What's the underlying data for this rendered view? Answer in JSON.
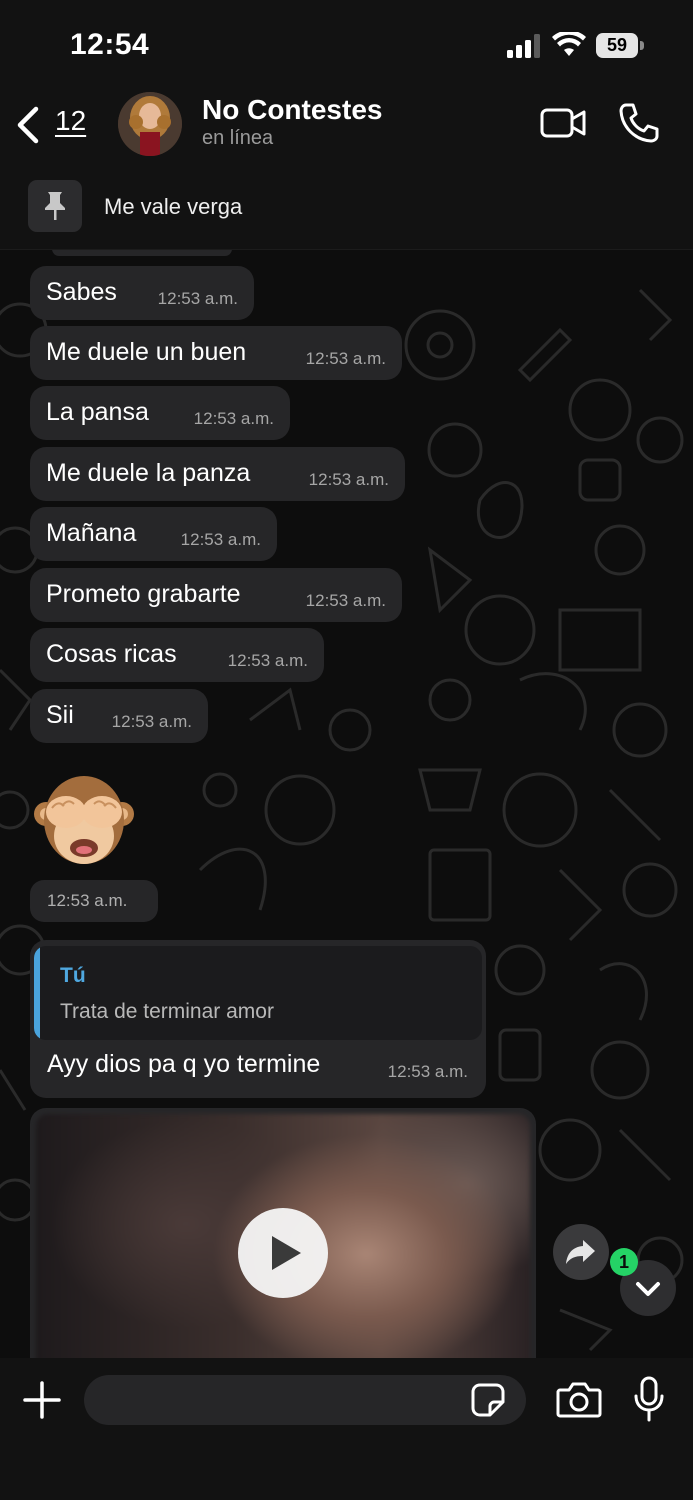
{
  "status_bar": {
    "time": "12:54",
    "battery": "59"
  },
  "header": {
    "back_count": "12",
    "contact_name": "No Contestes",
    "contact_status": "en línea"
  },
  "pinned": {
    "text": "Me vale verga"
  },
  "messages": [
    {
      "text": "Sabes",
      "time": "12:53 a.m."
    },
    {
      "text": "Me duele un buen",
      "time": "12:53 a.m."
    },
    {
      "text": "La pansa",
      "time": "12:53 a.m."
    },
    {
      "text": "Me duele la panza",
      "time": "12:53 a.m."
    },
    {
      "text": "Mañana",
      "time": "12:53 a.m."
    },
    {
      "text": "Prometo grabarte",
      "time": "12:53 a.m."
    },
    {
      "text": "Cosas ricas",
      "time": "12:53 a.m."
    },
    {
      "text": "Sii",
      "time": "12:53 a.m."
    }
  ],
  "emoji_message": {
    "emoji": "see-no-evil-monkey",
    "time": "12:53 a.m."
  },
  "reply_message": {
    "quoted_author": "Tú",
    "quoted_text": "Trata de terminar amor",
    "text": "Ayy dios pa q yo termine",
    "time": "12:53 a.m."
  },
  "video_message": {
    "icon": "play-icon"
  },
  "unread_badge": "1",
  "composer": {
    "placeholder": ""
  },
  "colors": {
    "bubble": "#262628",
    "quote_accent": "#4fa8e0",
    "badge": "#25d366",
    "background": "#0b0b0b"
  }
}
